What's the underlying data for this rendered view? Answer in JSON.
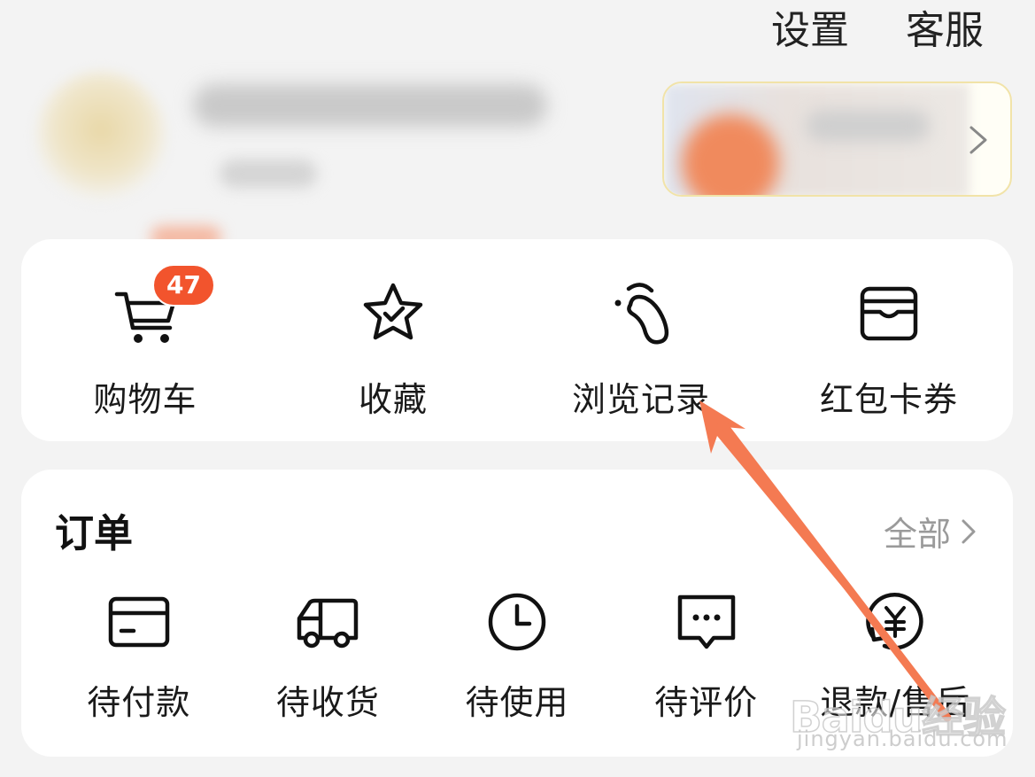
{
  "header": {
    "settings_label": "设置",
    "service_label": "客服"
  },
  "quick_links": [
    {
      "label": "购物车",
      "icon": "cart-icon",
      "badge": "47"
    },
    {
      "label": "收藏",
      "icon": "star-icon"
    },
    {
      "label": "浏览记录",
      "icon": "footprint-icon"
    },
    {
      "label": "红包卡券",
      "icon": "wallet-icon"
    }
  ],
  "orders": {
    "title": "订单",
    "all_label": "全部",
    "items": [
      {
        "label": "待付款",
        "icon": "card-icon"
      },
      {
        "label": "待收货",
        "icon": "truck-icon"
      },
      {
        "label": "待使用",
        "icon": "clock-icon"
      },
      {
        "label": "待评价",
        "icon": "comment-icon"
      },
      {
        "label": "退款/售后",
        "icon": "refund-icon"
      }
    ]
  },
  "watermark": {
    "brand": "Baidu经验",
    "url": "jingyan.baidu.com"
  },
  "colors": {
    "accent": "#f2542d",
    "arrow": "#f47a52",
    "muted": "#9a9a9a"
  }
}
